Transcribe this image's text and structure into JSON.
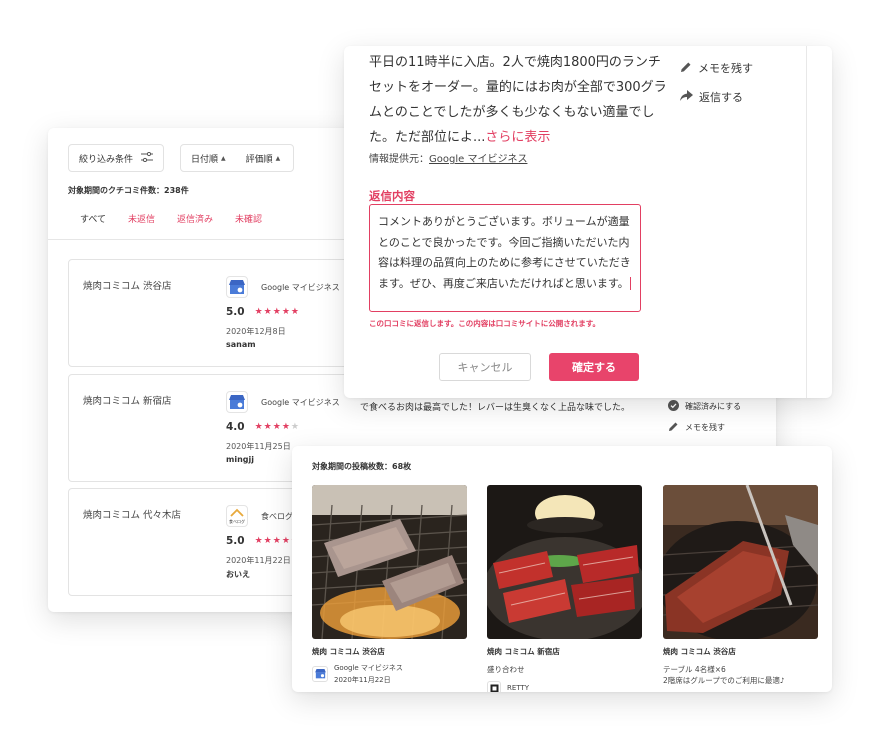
{
  "reviews_panel": {
    "filter_label": "絞り込み条件",
    "sort_date": "日付順",
    "sort_rating": "評価順",
    "review_count": "対象期間のクチコミ件数：238件",
    "tabs": [
      "すべて",
      "未返信",
      "返信済み",
      "未確認"
    ],
    "rows": [
      {
        "store": "焼肉コミコム 渋谷店",
        "source": "Google マイビジネス",
        "rating": "5.0",
        "stars": "★★★★★",
        "stars_off": "",
        "date": "2020年12月8日",
        "user": "sanam"
      },
      {
        "store": "焼肉コミコム 新宿店",
        "source": "Google マイビジネス",
        "rating": "4.0",
        "stars": "★★★★",
        "stars_off": "★",
        "date": "2020年11月25日",
        "user": "mingjj"
      },
      {
        "store": "焼肉コミコム 代々木店",
        "source": "食べログ",
        "rating": "5.0",
        "stars": "★★★★★",
        "stars_off": "",
        "date": "2020年11月22日",
        "user": "おいえ"
      }
    ],
    "row2_body": "い、コストパフォーマンスのよいお店です。表面だけ焼いて食べるレアで食べるお肉は最高でした！レバーは生臭くなく上品な味でした。",
    "row2_actions": {
      "confirm": "確認済みにする",
      "memo": "メモを残す"
    }
  },
  "reply_modal": {
    "review_text": "平日の11時半に入店。2人で焼肉1800円のランチセットをオーダー。量的にはお肉が全部で300グラムとのことでしたが多くも少なくもない適量でした。ただ部位によ...",
    "read_more": "さらに表示",
    "info_source_prefix": "情報提供元：",
    "info_source_link": "Google マイビジネス",
    "reply_label": "返信内容",
    "reply_value": "コメントありがとうございます。ボリュームが適量とのことで良かったです。今回ご指摘いただいた内容は料理の品質向上のために参考にさせていただきます。ぜひ、再度ご来店いただければと思います。",
    "reply_note": "この口コミに返信します。この内容は口コミサイトに公開されます。",
    "cancel": "キャンセル",
    "confirm": "確定する",
    "action_memo": "メモを残す",
    "action_reply": "返信する"
  },
  "photos_panel": {
    "count": "対象期間の投稿枚数：68枚",
    "items": [
      {
        "store": "焼肉 コミコム 渋谷店",
        "source": "Google マイビジネス",
        "date": "2020年11月22日"
      },
      {
        "store": "焼肉 コミコム 新宿店",
        "caption": "盛り合わせ",
        "source": "RETTY"
      },
      {
        "store": "焼肉 コミコム 渋谷店",
        "caption": "テーブル 4名様×6",
        "caption2": "2階席はグループでのご利用に最適♪"
      }
    ]
  },
  "colors": {
    "accent": "#e23f62",
    "button": "#e8446b",
    "gmb_blue": "#4a7bd8"
  }
}
